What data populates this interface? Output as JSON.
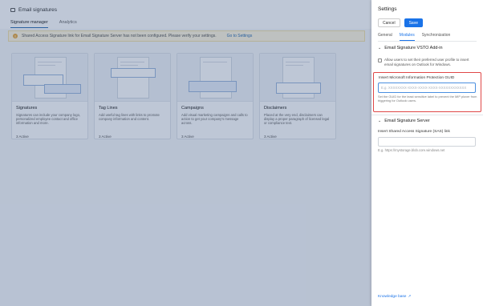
{
  "app": {
    "title": "Email signatures",
    "tabs": [
      {
        "label": "Signature manager"
      },
      {
        "label": "Analytics"
      }
    ],
    "banner": {
      "text": "Shared Access Signature link for Email Signature Server has not been configured. Please verify your settings.",
      "link": "Go to Settings"
    },
    "cards": [
      {
        "title": "Signatures",
        "desc": "Signatures can include your company logo, personalized employee contact and office information and more.",
        "status": "3 Active"
      },
      {
        "title": "Tag Lines",
        "desc": "Add useful tag lines with links to promote company information and content.",
        "status": "3 Active"
      },
      {
        "title": "Campaigns",
        "desc": "Add visual marketing campaigns and calls to action to get your company's message across.",
        "status": "3 Active"
      },
      {
        "title": "Disclaimers",
        "desc": "Placed at the very end, disclaimers can display a proper paragraph of licensed legal or compliance text.",
        "status": "3 Active"
      }
    ]
  },
  "panel": {
    "title": "Settings",
    "cancel": "Cancel",
    "save": "Save",
    "tabs": [
      {
        "label": "General"
      },
      {
        "label": "Modules"
      },
      {
        "label": "Synchronization"
      }
    ],
    "vsto": {
      "heading": "Email Signature VSTO Add-in",
      "checkbox_label": "Allow users to set their preferred user profile to insert email signatures on Outlook for Windows.",
      "mip_label": "Insert Microsoft Information Protection GUID",
      "mip_placeholder": "E.g. XXXXXXXX-XXXX-XXXX-XXXX-XXXXXXXXXXXX",
      "mip_help": "Set the GUID for the least sensitive label to prevent the MIP plover from triggering for Outlook users."
    },
    "server": {
      "heading": "Email Signature Server",
      "sas_label": "Insert Shared Access Signature (SAS) link",
      "sas_hint": "E.g. https://mystorage.blob.core.windows.net"
    },
    "knowledge_base": "Knowledge base"
  }
}
